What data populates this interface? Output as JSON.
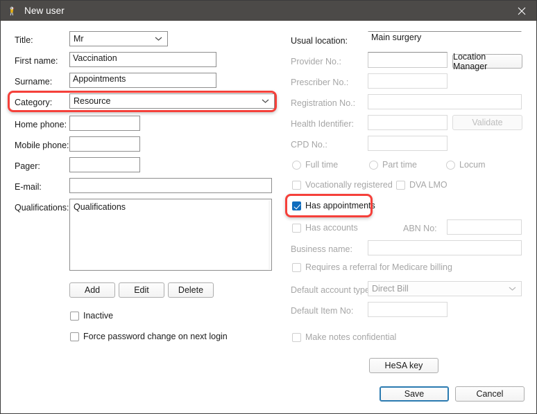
{
  "window": {
    "title": "New user",
    "icon": "bp-bird-icon",
    "close_label": "×",
    "titlebar_color": "#4c4a48",
    "accent_color": "#0f6cbd",
    "highlight_color": "#f5403a"
  },
  "left": {
    "title": {
      "label": "Title:",
      "value": "Mr"
    },
    "first_name": {
      "label": "First name:",
      "value": "Vaccination"
    },
    "surname": {
      "label": "Surname:",
      "value": "Appointments"
    },
    "category": {
      "label": "Category:",
      "value": "Resource",
      "highlighted": true
    },
    "home_phone": {
      "label": "Home phone:",
      "value": ""
    },
    "mobile_phone": {
      "label": "Mobile phone:",
      "value": ""
    },
    "pager": {
      "label": "Pager:",
      "value": ""
    },
    "email": {
      "label": "E-mail:",
      "value": ""
    },
    "qualifications": {
      "label": "Qualifications:",
      "value": "Qualifications"
    },
    "buttons": {
      "add": "Add",
      "edit": "Edit",
      "delete": "Delete"
    },
    "inactive": {
      "label": "Inactive",
      "checked": false
    },
    "force_password": {
      "label": "Force password change on next login",
      "checked": false
    }
  },
  "right": {
    "usual_location": {
      "label": "Usual location:",
      "value": "Main surgery"
    },
    "provider_no": {
      "label": "Provider No.:",
      "value": "",
      "disabled": true
    },
    "location_manager_button": "Location Manager",
    "prescriber_no": {
      "label": "Prescriber No.:",
      "value": "",
      "disabled": true
    },
    "registration_no": {
      "label": "Registration No.:",
      "value": "",
      "disabled": true
    },
    "health_identifier": {
      "label": "Health Identifier:",
      "value": "",
      "disabled": true
    },
    "validate_button": "Validate",
    "cpd_no": {
      "label": "CPD No.:",
      "value": "",
      "disabled": true
    },
    "employment": [
      {
        "label": "Full time",
        "selected": false
      },
      {
        "label": "Part time",
        "selected": false
      },
      {
        "label": "Locum",
        "selected": false
      }
    ],
    "vocationally_registered": {
      "label": "Vocationally registered",
      "checked": false,
      "disabled": true
    },
    "dva_lmo": {
      "label": "DVA LMO",
      "checked": false,
      "disabled": true
    },
    "has_appointments": {
      "label": "Has appointments",
      "checked": true,
      "highlighted": true
    },
    "has_accounts": {
      "label": "Has accounts",
      "checked": false,
      "disabled": true
    },
    "abn_no": {
      "label": "ABN No:",
      "value": "",
      "disabled": true
    },
    "business_name": {
      "label": "Business name:",
      "value": "",
      "disabled": true
    },
    "requires_referral": {
      "label": "Requires a referral for Medicare billing",
      "checked": false,
      "disabled": true
    },
    "default_account_type": {
      "label": "Default account type:",
      "value": "Direct Bill",
      "disabled": true
    },
    "default_item_no": {
      "label": "Default Item No:",
      "value": "",
      "disabled": true
    },
    "make_notes_confidential": {
      "label": "Make notes confidential",
      "checked": false,
      "disabled": true
    },
    "hesa_key_button": "HeSA key"
  },
  "footer": {
    "save": "Save",
    "cancel": "Cancel"
  }
}
